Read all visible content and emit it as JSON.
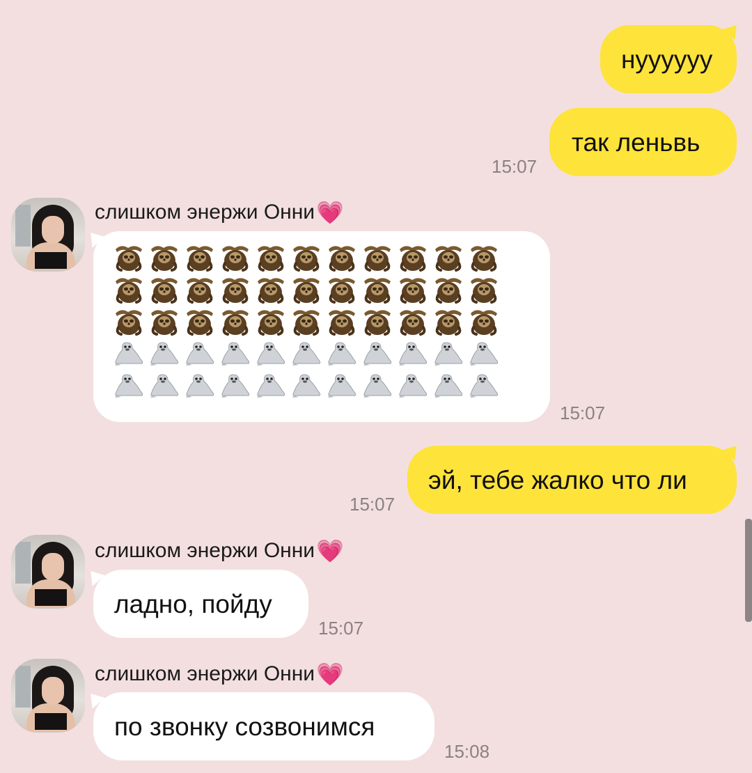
{
  "colors": {
    "background": "#f3dfe0",
    "outgoing_bubble": "#fee33b",
    "incoming_bubble": "#ffffff",
    "timestamp": "#8a8182"
  },
  "messages": [
    {
      "id": "m1",
      "direction": "out",
      "text": "нуууууу",
      "time": ""
    },
    {
      "id": "m2",
      "direction": "out",
      "text": "так леньвь",
      "time": "15:07"
    },
    {
      "id": "m3",
      "direction": "in",
      "sender": "слишком энержи Онни",
      "sender_emoji": "heart-icon",
      "content": "emoji-grid",
      "emoji_rows": [
        {
          "emoji": "sloth-icon",
          "count": 11
        },
        {
          "emoji": "sloth-icon",
          "count": 11
        },
        {
          "emoji": "sloth-icon",
          "count": 11
        },
        {
          "emoji": "seal-icon",
          "count": 11
        },
        {
          "emoji": "seal-icon",
          "count": 11
        }
      ],
      "time": "15:07"
    },
    {
      "id": "m4",
      "direction": "out",
      "text": "эй, тебе жалко что ли",
      "time": "15:07"
    },
    {
      "id": "m5",
      "direction": "in",
      "sender": "слишком энержи Онни",
      "sender_emoji": "heart-icon",
      "text": "ладно, пойду",
      "time": "15:07"
    },
    {
      "id": "m6",
      "direction": "in",
      "sender": "слишком энержи Онни",
      "sender_emoji": "heart-icon",
      "text": "по звонку созвонимся",
      "time": "15:08"
    }
  ]
}
